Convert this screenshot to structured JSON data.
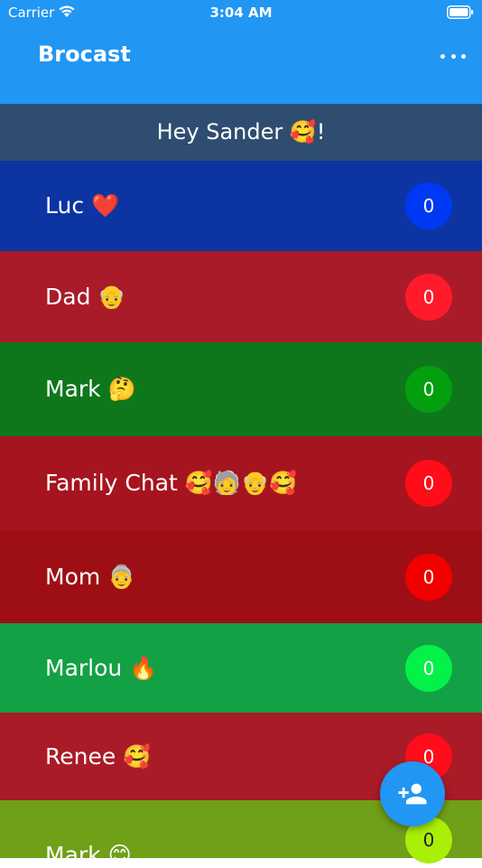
{
  "status_bar": {
    "carrier": "Carrier",
    "time": "3:04 AM",
    "wifi_icon": "wifi-icon",
    "battery_icon": "battery-icon"
  },
  "app_bar": {
    "title": "Brocast",
    "menu_icon": "more-horiz-icon",
    "background": "#2196f3"
  },
  "greeting": {
    "text": "Hey Sander 🥰!",
    "background": "#2e4d70"
  },
  "chats": [
    {
      "name": "Luc ❤️",
      "unread": "0",
      "row_color": "#0d34a3",
      "badge_color": "#0039f4"
    },
    {
      "name": "Dad 👴",
      "unread": "0",
      "row_color": "#a91b29",
      "badge_color": "#ff1b2a"
    },
    {
      "name": "Mark 🤔",
      "unread": "0",
      "row_color": "#0f771b",
      "badge_color": "#049f0f"
    },
    {
      "name": "Family Chat 🥰🧓👴🥰",
      "unread": "0",
      "row_color": "#a6141f",
      "badge_color": "#ff0d19"
    },
    {
      "name": "Mom 👵",
      "unread": "0",
      "row_color": "#9e0f15",
      "badge_color": "#f20000"
    },
    {
      "name": "Marlou 🔥",
      "unread": "0",
      "row_color": "#13a145",
      "badge_color": "#04f149"
    },
    {
      "name": "Renee 🥰",
      "unread": "0",
      "row_color": "#a81b27",
      "badge_color": "#ff0d1b"
    },
    {
      "name": "Mark 😊",
      "unread": "0",
      "row_color": "#709f18",
      "badge_color": "#a9ef07"
    }
  ],
  "fab": {
    "icon": "person-add-icon",
    "background": "#2196f3"
  }
}
